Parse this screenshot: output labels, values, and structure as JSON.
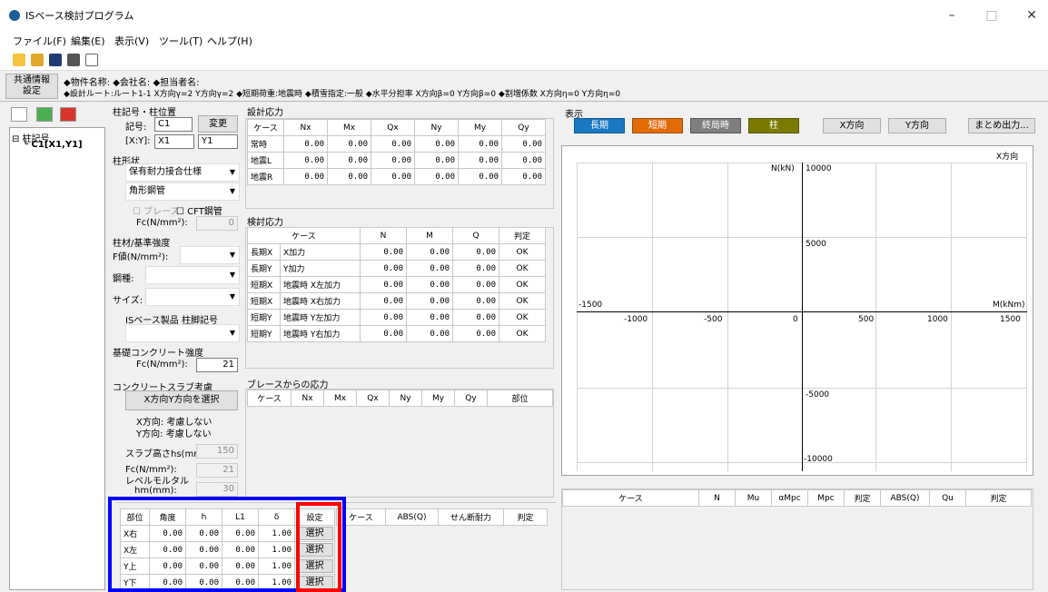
{
  "window": {
    "title": "ISベース検討プログラム",
    "minimize": "–",
    "maximize": "□",
    "close": "✕"
  },
  "menu": [
    "ファイル(F)",
    "編集(E)",
    "表示(V)",
    "ツール(T)",
    "ヘルプ(H)"
  ],
  "info": {
    "common_btn_1": "共通情報",
    "common_btn_2": "設定",
    "line1": "◆物件名称:  ◆会社名:  ◆担当者名:",
    "line2": "◆設計ルート:ルート1-1  X方向γ=2  Y方向γ=2     ◆短期荷重:地震時   ◆積雪指定:一般  ◆水平分担率  X方向β=0  Y方向β=0  ◆割増係数  X方向η=0  Y方向η=0"
  },
  "tree": {
    "root": "柱記号",
    "child": "C1[X1,Y1]"
  },
  "column_pos": {
    "group": "柱記号・柱位置",
    "symbol_label": "記号:",
    "symbol_value": "C1",
    "change_btn": "変更",
    "xy_label": "[X:Y]:",
    "x_value": "X1",
    "y_value": "Y1"
  },
  "column_shape": {
    "group": "柱形状",
    "combo1": "保有耐力接合仕様",
    "combo2": "角形鋼管",
    "brace": "ブレース",
    "cft": "CFT鋼管",
    "fc_label": "Fc(N/mm²):",
    "fc_value": "0"
  },
  "column_material": {
    "group": "柱材/基準強度",
    "f_label": "F値(N/mm²):",
    "steel_label": "鋼種:",
    "size_label": "サイズ:",
    "product_label": "ISベース製品 柱脚記号"
  },
  "foundation": {
    "group": "基礎コンクリート強度",
    "fc_label": "Fc(N/mm²):",
    "fc_value": "21"
  },
  "slab": {
    "group": "コンクリートスラブ考慮",
    "select_btn": "X方向Y方向を選択",
    "x_status": "X方向: 考慮しない",
    "y_status": "Y方向: 考慮しない",
    "height_label": "スラブ高さhs(mm):",
    "height_value": "150",
    "fc_label": "Fc(N/mm²):",
    "fc_value": "21",
    "mortar_label_1": "レベルモルタル",
    "mortar_label_2": "hm(mm):",
    "mortar_value": "30"
  },
  "design_stress": {
    "group": "設計応力",
    "headers": [
      "ケース",
      "Nx",
      "Mx",
      "Qx",
      "Ny",
      "My",
      "Qy"
    ],
    "rows": [
      [
        "常時",
        "0.00",
        "0.00",
        "0.00",
        "0.00",
        "0.00",
        "0.00"
      ],
      [
        "地震L",
        "0.00",
        "0.00",
        "0.00",
        "0.00",
        "0.00",
        "0.00"
      ],
      [
        "地震R",
        "0.00",
        "0.00",
        "0.00",
        "0.00",
        "0.00",
        "0.00"
      ]
    ]
  },
  "check_stress": {
    "group": "検討応力",
    "headers": [
      "ケース",
      "N",
      "M",
      "Q",
      "判定"
    ],
    "rows": [
      [
        "長期X",
        "X加力",
        "0.00",
        "0.00",
        "0.00",
        "OK"
      ],
      [
        "長期Y",
        "Y加力",
        "0.00",
        "0.00",
        "0.00",
        "OK"
      ],
      [
        "短期X",
        "地震時 X左加力",
        "0.00",
        "0.00",
        "0.00",
        "OK"
      ],
      [
        "短期X",
        "地震時 X右加力",
        "0.00",
        "0.00",
        "0.00",
        "OK"
      ],
      [
        "短期Y",
        "地震時 Y左加力",
        "0.00",
        "0.00",
        "0.00",
        "OK"
      ],
      [
        "短期Y",
        "地震時 Y右加力",
        "0.00",
        "0.00",
        "0.00",
        "OK"
      ]
    ]
  },
  "brace_stress": {
    "group": "ブレースからの応力",
    "headers": [
      "ケース",
      "Nx",
      "Mx",
      "Qx",
      "Ny",
      "My",
      "Qy",
      "部位"
    ]
  },
  "bottom_table": {
    "headers": [
      "部位",
      "角度",
      "h",
      "L1",
      "δ",
      "設定"
    ],
    "rows": [
      [
        "X右",
        "0.00",
        "0.00",
        "0.00",
        "1.00",
        "選択"
      ],
      [
        "X左",
        "0.00",
        "0.00",
        "0.00",
        "1.00",
        "選択"
      ],
      [
        "Y上",
        "0.00",
        "0.00",
        "0.00",
        "1.00",
        "選択"
      ],
      [
        "Y下",
        "0.00",
        "0.00",
        "0.00",
        "1.00",
        "選択"
      ]
    ]
  },
  "shear_table": {
    "headers": [
      "ケース",
      "ABS(Q)",
      "せん断耐力",
      "判定"
    ]
  },
  "display": {
    "group": "表示",
    "buttons": [
      {
        "label": "長期",
        "color": "#1a78c2"
      },
      {
        "label": "短期",
        "color": "#e36c09"
      },
      {
        "label": "終局時",
        "color": "#7f7f7f"
      },
      {
        "label": "柱",
        "color": "#7a7a00"
      }
    ],
    "x_dir_btn": "X方向",
    "y_dir_btn": "Y方向",
    "summary_btn": "まとめ出力..."
  },
  "chart": {
    "dir_label": "X方向",
    "y_axis_label": "N(kN)",
    "x_axis_label": "M(kNm)",
    "y_ticks": [
      "10000",
      "5000",
      "-5000",
      "-10000"
    ],
    "x_left_label": "-1500",
    "x_ticks": [
      "-1000",
      "-500",
      "0",
      "500",
      "1000",
      "1500"
    ]
  },
  "result_table": {
    "headers": [
      "ケース",
      "N",
      "Mu",
      "αMpc",
      "Mpc",
      "判定",
      "ABS(Q)",
      "Qu",
      "判定"
    ]
  },
  "highlight": {
    "blue": "#0000ff",
    "red": "#ff0000"
  }
}
